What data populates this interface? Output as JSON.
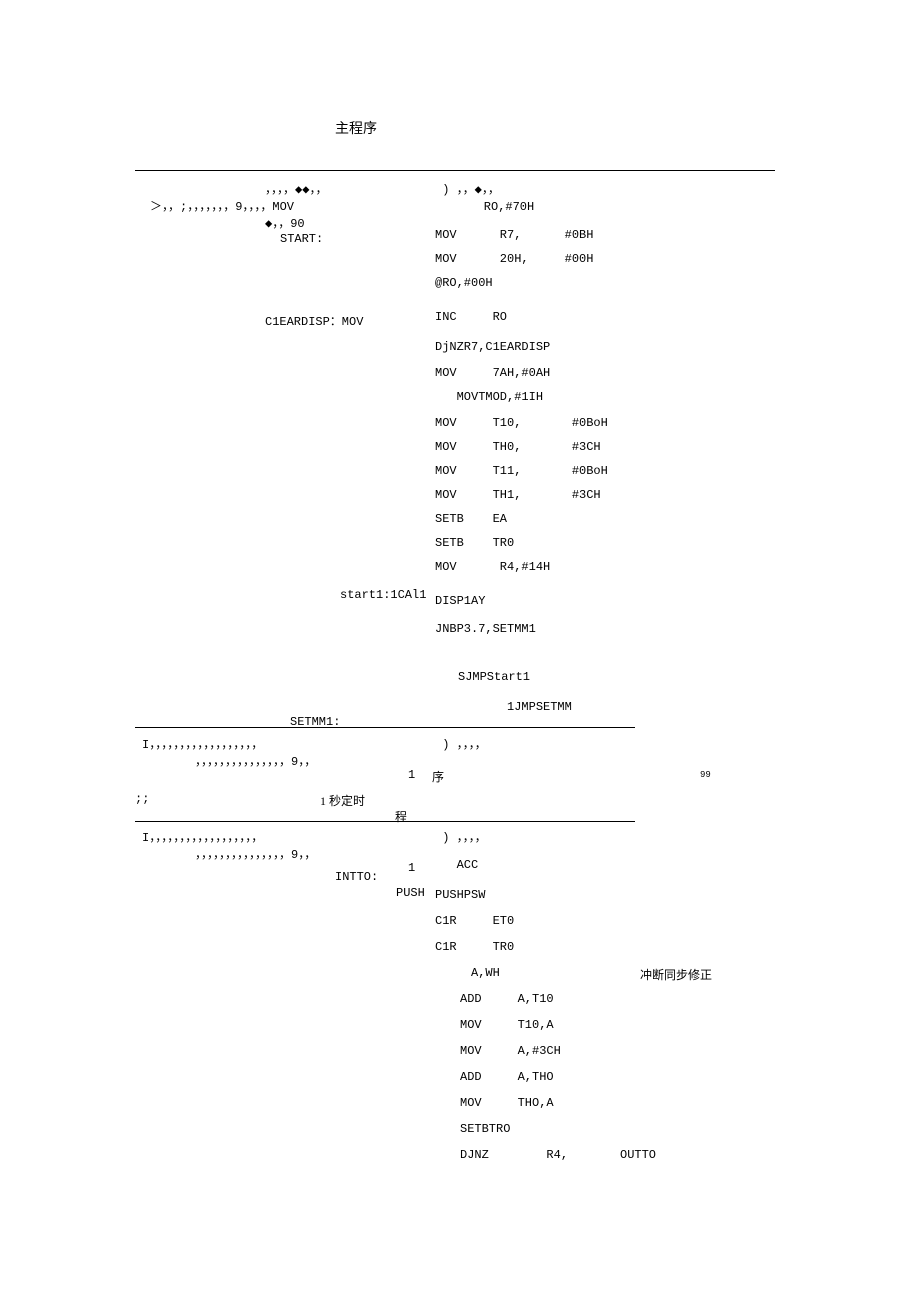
{
  "title": "主程序",
  "block1": {
    "line1_left": "，，，，◆◆，，",
    "line1_right": " ) ，，◆，，",
    "line2_left": "＞，，;，，，，，，，9，，，，MOV",
    "line2_right_indent": "    RO,#70H",
    "line3_left": "◆，，90",
    "line4_left": "START:",
    "r1": "MOV      R7,      #0BH",
    "r2": "MOV      20H,     #00H",
    "r3": "@RO,#00H",
    "cldisp_left": "C1EARDISP：MOV",
    "r4": "INC     RO",
    "r5": "DjNZR7,C1EARDISP",
    "r6": "MOV     7AH,#0AH",
    "r7": "   MOVTMOD,#1IH",
    "r8": "MOV     T10,       #0BoH",
    "r9": "MOV     TH0,       #3CH",
    "r10": "MOV     T11,       #0BoH",
    "r11": "MOV     TH1,       #3CH",
    "r12": "SETB    EA",
    "r13": "SETB    TR0",
    "r14": "MOV      R4,#14H",
    "start1_left": "start1:1CAl1",
    "r15": "DISP1AY",
    "r16": "JNBP3.7,SETMM1",
    "r17": "SJMPStart1",
    "setmm_left": "SETMM1:",
    "r18": "          1JMPSETMM"
  },
  "block2": {
    "hr_top_left": "I，，，，，，，，，，，，，，，，，，",
    "hr_top_right": " ) ，，，，",
    "hr_line2": "，，，，，，，，，，，，，，，9，，",
    "one": "1",
    "label_main": "序",
    "semicolons": ";;",
    "one_sec": "1 秒定时",
    "cheng": "程",
    "quote99": "99"
  },
  "block3": {
    "hr_top_left": "I，，，，，，，，，，，，，，，，，，",
    "hr_top_right": " ) ，，，，",
    "hr_line2": "，，，，，，，，，，，，，，，9，，",
    "one": "1",
    "intto": "INTTO:",
    "push": "PUSH",
    "acc": "   ACC",
    "r1": "PUSHPSW",
    "r2": "C1R     ET0",
    "r3": "C1R     TR0",
    "r4": "     A,WH",
    "note": "冲断同步修正",
    "r5": "ADD     A,T10",
    "r6": "MOV     T10,A",
    "r7": "MOV     A,#3CH",
    "r8": "ADD     A,THO",
    "r9": "MOV     THO,A",
    "r10": "SETBTRO",
    "r11": "DJNZ        R4,",
    "r11b": "OUTTO"
  }
}
